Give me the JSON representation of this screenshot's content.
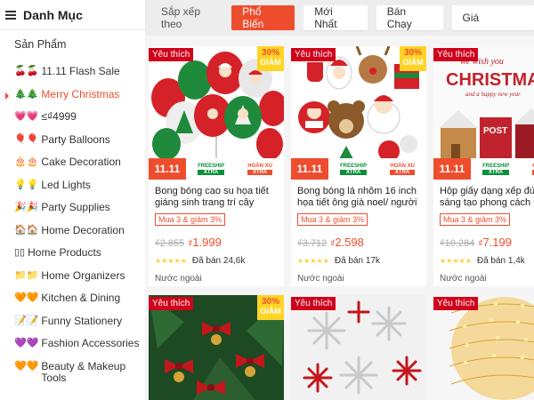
{
  "sidebar": {
    "title": "Danh Mục",
    "root": "Sản Phẩm",
    "items": [
      {
        "icon": "🍒🍒",
        "label": "11.11 Flash Sale",
        "active": false
      },
      {
        "icon": "🎄🎄",
        "label": "Merry Christmas",
        "active": true
      },
      {
        "icon": "💗💗",
        "label": "≤₫4999",
        "active": false
      },
      {
        "icon": "🎈🎈",
        "label": "Party Balloons",
        "active": false
      },
      {
        "icon": "🎂🎂",
        "label": "Cake Decoration",
        "active": false
      },
      {
        "icon": "💡💡",
        "label": "Led Lights",
        "active": false
      },
      {
        "icon": "🎉🎉",
        "label": "Party Supplies",
        "active": false
      },
      {
        "icon": "🏠🏠",
        "label": "Home Decoration",
        "active": false
      },
      {
        "icon": "▯▯",
        "label": "Home Products",
        "active": false
      },
      {
        "icon": "📁📁",
        "label": "Home Organizers",
        "active": false
      },
      {
        "icon": "🧡🧡",
        "label": "Kitchen & Dining",
        "active": false
      },
      {
        "icon": "📝📝",
        "label": "Funny Stationery",
        "active": false
      },
      {
        "icon": "💜💜",
        "label": "Fashion Accessories",
        "active": false
      },
      {
        "icon": "🧡🧡",
        "label": "Beauty & Makeup Tools",
        "active": false
      }
    ]
  },
  "sortbar": {
    "label": "Sắp xếp theo",
    "buttons": [
      "Phổ Biến",
      "Mới Nhất",
      "Bán Chạy"
    ],
    "active_index": 0,
    "price": "Giá"
  },
  "badges": {
    "favorite": "Yêu thích",
    "discount_pct": "30%",
    "discount_word": "GIẢM",
    "sale_label": "11.11",
    "freeship_top": "FREESHIP",
    "freeship_bottom": "XTRA",
    "cashback_top": "HOÀN XU",
    "cashback_bottom": "XTRA"
  },
  "products": [
    {
      "name": "Bong bóng cao su họa tiết giáng sinh trang trí cây thông noel…",
      "tag": "Mua 3 & giảm 3%",
      "old_price": "₫2.855",
      "currency": "₫",
      "new_price": "1.999",
      "rating": 5,
      "sold": "Đã bán 24,6k",
      "origin": "Nước ngoài"
    },
    {
      "name": "Bong bóng lá nhôm 16 inch họa tiết ông già noel/ người tuyết…",
      "tag": "Mua 3 & giảm 3%",
      "old_price": "₫3.712",
      "currency": "₫",
      "new_price": "2.598",
      "rating": 5,
      "sold": "Đã bán 17k",
      "origin": "Nước ngoài"
    },
    {
      "name": "Hộp giấy dạng xếp đứng sáng tạo phong cách Giá…",
      "tag": "Mua 3 & giảm 3%",
      "old_price": "₫10.284",
      "currency": "₫",
      "new_price": "7.199",
      "rating": 5,
      "sold": "Đã bán 1,4k",
      "origin": "Nước ngoài"
    }
  ],
  "art_text": {
    "box_line1": "we wish you",
    "box_line2": "CHRISTMAS",
    "box_line3": "and a happy new year",
    "box_post": "POST"
  },
  "colors": {
    "brand": "#ee4d2d",
    "favorite_badge": "#d0011b",
    "discount_badge": "#ffd424",
    "star": "#ffce3d"
  }
}
